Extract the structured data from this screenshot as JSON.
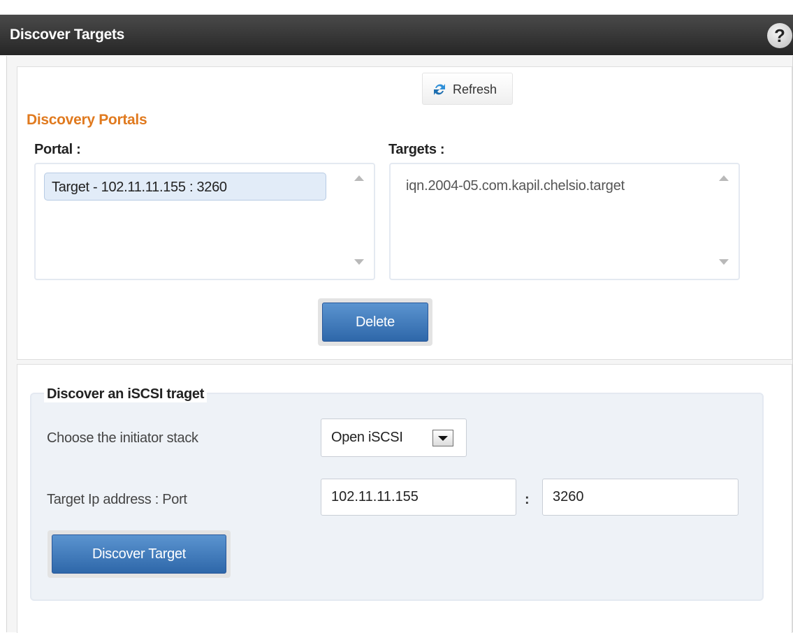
{
  "window": {
    "title": "Discover Targets",
    "help_label": "?"
  },
  "toolbar": {
    "refresh_label": "Refresh"
  },
  "discovery_portals": {
    "heading": "Discovery Portals",
    "portal_label": "Portal :",
    "targets_label": "Targets :",
    "portals": [
      "Target - 102.11.11.155 : 3260"
    ],
    "targets": [
      "iqn.2004-05.com.kapil.chelsio.target"
    ],
    "delete_label": "Delete"
  },
  "discover_form": {
    "legend": "Discover an iSCSI traget",
    "stack_label": "Choose the initiator stack",
    "stack_value": "Open iSCSI",
    "address_label": "Target Ip address : Port",
    "ip_value": "102.11.11.155",
    "separator": ":",
    "port_value": "3260",
    "discover_label": "Discover Target"
  },
  "colors": {
    "accent": "#e07a1f",
    "button_blue": "#3a75b8",
    "titlebar": "#333333"
  }
}
